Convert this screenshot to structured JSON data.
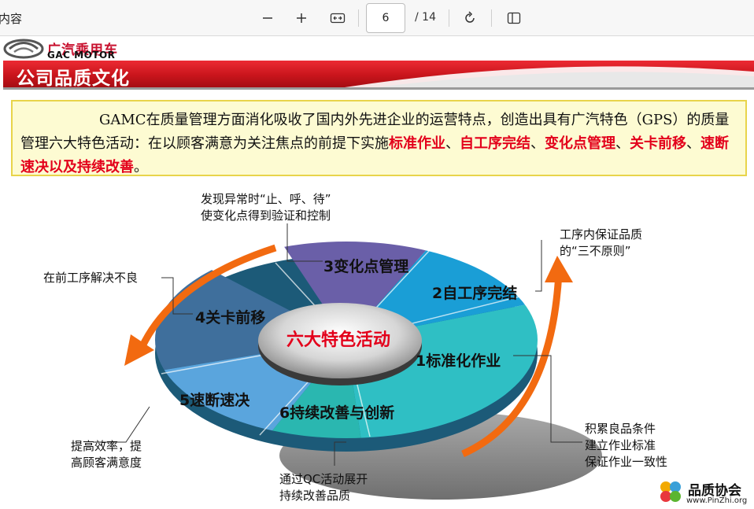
{
  "toolbar": {
    "title": "内容",
    "current_page": "6",
    "total_pages": "/ 14",
    "icons": [
      "zoom-out-icon",
      "zoom-in-icon",
      "fit-width-icon",
      "rotate-icon",
      "page-view-icon"
    ]
  },
  "slide": {
    "logo": {
      "cn": "广汽乘用车",
      "en": "GAC MOTOR"
    },
    "title": "公司品质文化",
    "intro": {
      "part1": "GAMC在质量管理方面消化吸收了国内外先进企业的运营特点，创造出具有广汽特色（GPS）的质量管理六大特色活动：在以顾客满意为关注焦点的前提下实施",
      "red1": "标准作业",
      "sep1": "、",
      "red2": "自工序完结",
      "sep2": "、",
      "red3": "变化点管理",
      "sep3": "、",
      "red4": "关卡前移",
      "sep4": "、",
      "red5": "速断速决以及持续改善",
      "end": "。"
    },
    "diagram": {
      "center": "六大特色活动",
      "segments": [
        {
          "label": "1标准化作业"
        },
        {
          "label": "2自工序完结"
        },
        {
          "label": "3变化点管理"
        },
        {
          "label": "4关卡前移"
        },
        {
          "label": "5速断速决"
        },
        {
          "label": "6持续改善与创新"
        }
      ],
      "callouts": {
        "change_point": [
          "发现异常时“止、呼、待”",
          "使变化点得到验证和控制"
        ],
        "self_process": [
          "工序内保证品质",
          "的“三不原则”"
        ],
        "gate_forward": [
          "在前工序解决不良"
        ],
        "standard_work": [
          "积累良品条件",
          "建立作业标准",
          "保证作业一致性"
        ],
        "quick_response": [
          "提高效率，提",
          "高顾客满意度"
        ],
        "continuous": [
          "通过QC活动展开",
          "持续改善品质"
        ]
      },
      "colors": {
        "seg1": "#2fbfc4",
        "seg2": "#1a9ed6",
        "seg3": "#6a5fa8",
        "seg4": "#3f6f9c",
        "seg5": "#5aa5dd",
        "seg6": "#2ab7b0",
        "arrow": "#f26a10",
        "center_text": "#e3001b"
      }
    },
    "watermark": {
      "cn": "品质协会",
      "url": "www.PinZhi.org"
    }
  }
}
